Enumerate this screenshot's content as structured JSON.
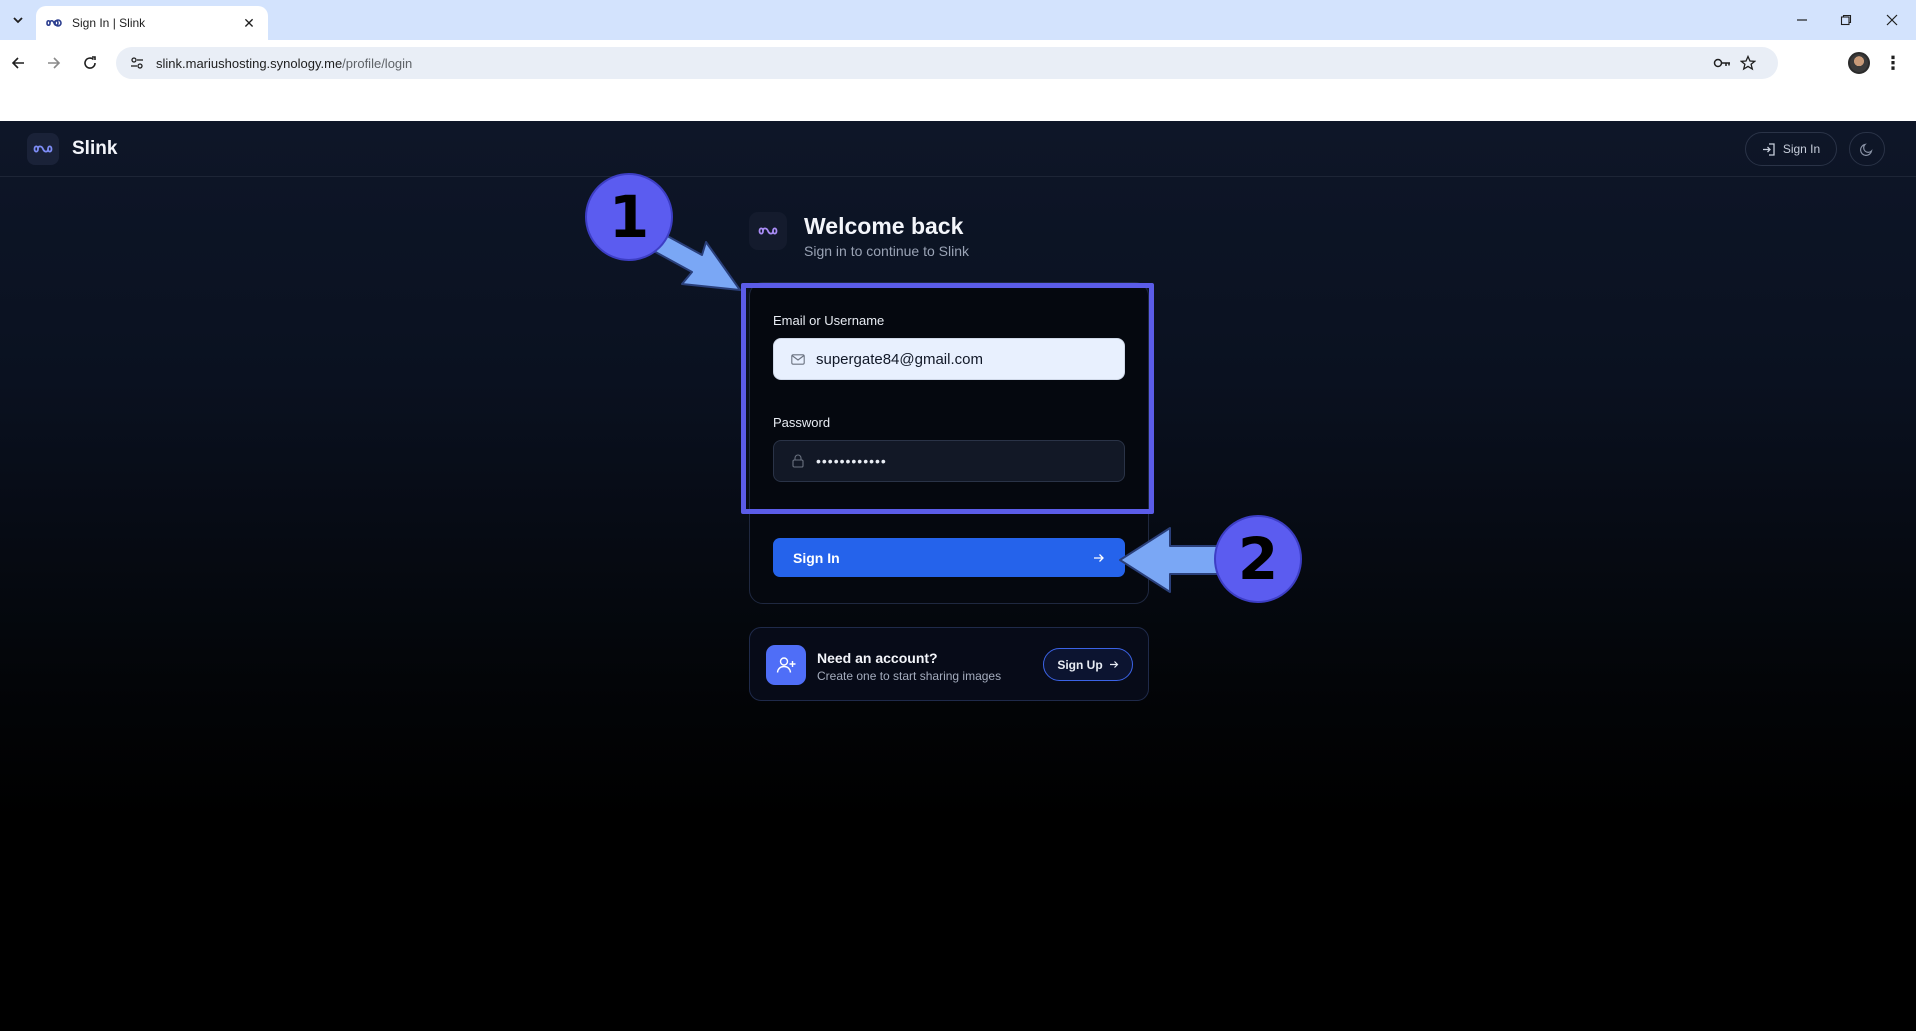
{
  "browser": {
    "tab_title": "Sign In | Slink",
    "url_host": "slink.mariushosting.synology.me",
    "url_path": "/profile/login"
  },
  "app": {
    "brand_name": "Slink",
    "header_signin_label": "Sign In"
  },
  "login": {
    "title": "Welcome back",
    "subtitle": "Sign in to continue to Slink",
    "email_label": "Email or Username",
    "email_value": "supergate84@gmail.com",
    "password_label": "Password",
    "password_value": "••••••••••••",
    "submit_label": "Sign In"
  },
  "signup_prompt": {
    "title": "Need an account?",
    "subtitle": "Create one to start sharing images",
    "button_label": "Sign Up"
  },
  "annotations": {
    "step1": "1",
    "step2": "2"
  },
  "colors": {
    "accent": "#2563eb",
    "annotation": "#5b5cf0",
    "arrow": "#7aa7f5"
  }
}
